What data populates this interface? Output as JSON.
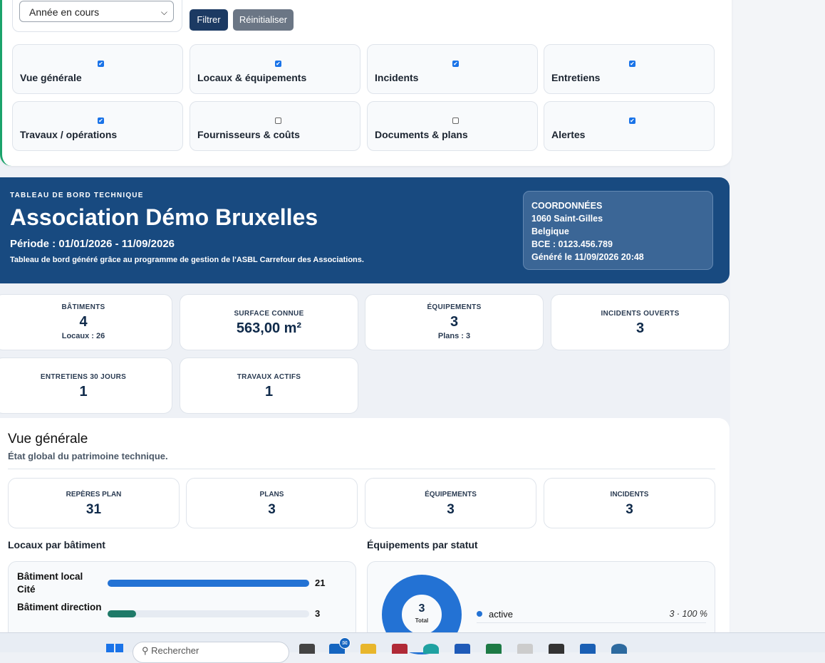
{
  "filters": {
    "period_select": "Année en cours",
    "filter_label": "Filtrer",
    "reset_label": "Réinitialiser",
    "modules": [
      {
        "label": "Vue générale",
        "checked": true
      },
      {
        "label": "Locaux & équipements",
        "checked": true
      },
      {
        "label": "Incidents",
        "checked": true
      },
      {
        "label": "Entretiens",
        "checked": true
      },
      {
        "label": "Travaux / opérations",
        "checked": true
      },
      {
        "label": "Fournisseurs & coûts",
        "checked": false
      },
      {
        "label": "Documents & plans",
        "checked": false
      },
      {
        "label": "Alertes",
        "checked": true
      }
    ]
  },
  "header": {
    "kicker": "TABLEAU DE BORD TECHNIQUE",
    "org_name": "Association Démo Bruxelles",
    "period": "Période : 01/01/2026 - 11/09/2026",
    "description": "Tableau de bord généré grâce au programme de gestion de l'ASBL Carrefour des Associations.",
    "coords": {
      "title": "COORDONNÉES",
      "city": "1060 Saint-Gilles",
      "country": "Belgique",
      "bce": "BCE : 0123.456.789",
      "generated": "Généré le 11/09/2026 20:48"
    }
  },
  "kpis": [
    {
      "title": "BÂTIMENTS",
      "value": "4",
      "sub": "Locaux : 26"
    },
    {
      "title": "SURFACE CONNUE",
      "value": "563,00 m²",
      "sub": ""
    },
    {
      "title": "ÉQUIPEMENTS",
      "value": "3",
      "sub": "Plans : 3"
    },
    {
      "title": "INCIDENTS OUVERTS",
      "value": "3",
      "sub": ""
    },
    {
      "title": "ENTRETIENS 30 JOURS",
      "value": "1",
      "sub": ""
    },
    {
      "title": "TRAVAUX ACTIFS",
      "value": "1",
      "sub": ""
    }
  ],
  "overview": {
    "title": "Vue générale",
    "subtitle": "État global du patrimoine technique.",
    "stats": [
      {
        "title": "REPÈRES PLAN",
        "value": "31"
      },
      {
        "title": "PLANS",
        "value": "3"
      },
      {
        "title": "ÉQUIPEMENTS",
        "value": "3"
      },
      {
        "title": "INCIDENTS",
        "value": "3"
      }
    ],
    "locaux_title": "Locaux par bâtiment",
    "locaux": [
      {
        "name": "Bâtiment local Cité",
        "value": "21",
        "fraction": 1.0,
        "color": "#2372d4"
      },
      {
        "name": "Bâtiment direction",
        "value": "3",
        "fraction": 0.14,
        "color": "#1f7a68"
      }
    ],
    "equip_title": "Équipements par statut",
    "donut": {
      "total": "3",
      "total_label": "Total",
      "color": "#2372d4"
    },
    "legend": [
      {
        "label": "active",
        "value": "3 · 100 %"
      }
    ]
  },
  "taskbar": {
    "search_placeholder": "Rechercher"
  }
}
